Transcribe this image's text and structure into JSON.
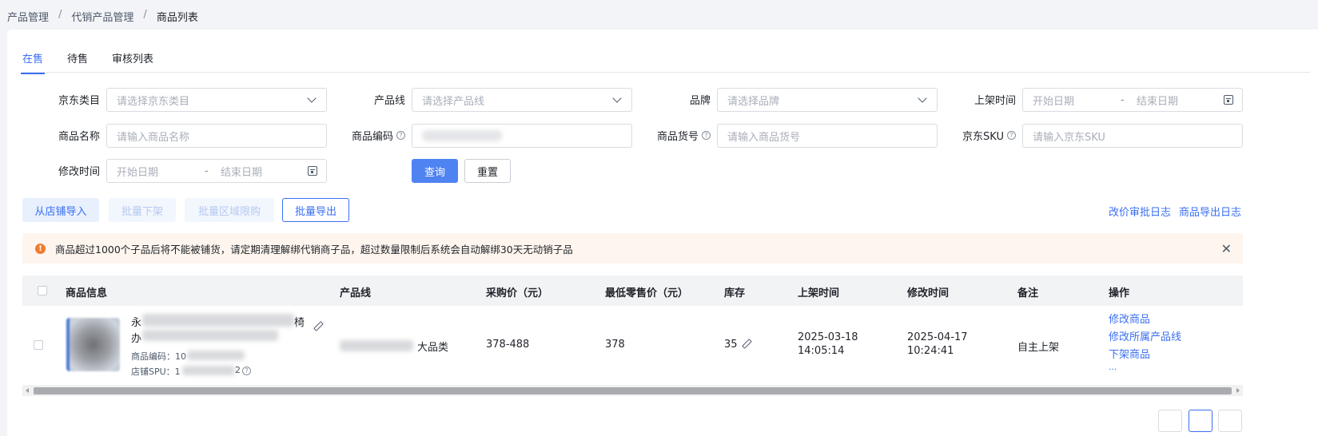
{
  "breadcrumb": [
    "产品管理",
    "代销产品管理",
    "商品列表"
  ],
  "tabs": [
    {
      "label": "在售",
      "active": true
    },
    {
      "label": "待售",
      "active": false
    },
    {
      "label": "审核列表",
      "active": false
    }
  ],
  "filters": {
    "jd_category": {
      "label": "京东类目",
      "placeholder": "请选择京东类目"
    },
    "product_line": {
      "label": "产品线",
      "placeholder": "请选择产品线"
    },
    "brand": {
      "label": "品牌",
      "placeholder": "请选择品牌"
    },
    "shelf_time": {
      "label": "上架时间",
      "start": "开始日期",
      "end": "结束日期"
    },
    "product_name": {
      "label": "商品名称",
      "placeholder": "请输入商品名称"
    },
    "product_code": {
      "label": "商品编码"
    },
    "product_sku_no": {
      "label": "商品货号",
      "placeholder": "请输入商品货号"
    },
    "jd_sku": {
      "label": "京东SKU",
      "placeholder": "请输入京东SKU"
    },
    "modify_time": {
      "label": "修改时间",
      "start": "开始日期",
      "end": "结束日期"
    },
    "date_sep": "-"
  },
  "actions": {
    "query": "查询",
    "reset": "重置",
    "import_from_store": "从店铺导入",
    "batch_offshelf": "批量下架",
    "batch_region_limit": "批量区域限购",
    "batch_export": "批量导出",
    "price_audit_log": "改价审批日志",
    "export_log": "商品导出日志"
  },
  "alert": {
    "text": "商品超过1000个子品后将不能被铺货，请定期清理解绑代销商子品，超过数量限制后系统会自动解绑30天无动销子品",
    "icon": "warning-icon",
    "color": "#f27a2e"
  },
  "table": {
    "columns": [
      "商品信息",
      "产品线",
      "采购价（元）",
      "最低零售价（元）",
      "库存",
      "上架时间",
      "修改时间",
      "备注",
      "操作"
    ],
    "rows": [
      {
        "title_start": "永",
        "title_end": "椅",
        "title_line2": "办",
        "code_label": "商品编码：10",
        "spu_label": "店铺SPU：1",
        "spu_tail": "2",
        "product_line_suffix": "大品类",
        "purchase_price": "378-488",
        "min_retail_price": "378",
        "stock": "35",
        "shelf_date": "2025-03-18",
        "shelf_clock": "14:05:14",
        "modify_date": "2025-04-17",
        "modify_clock": "10:24:41",
        "remark": "自主上架",
        "ops": [
          "修改商品",
          "修改所属产品线",
          "下架商品",
          "..."
        ]
      }
    ]
  },
  "colors": {
    "accent": "#3a6ff2",
    "primary_button": "#4f83f2",
    "alert_bg": "#fef5ee"
  }
}
